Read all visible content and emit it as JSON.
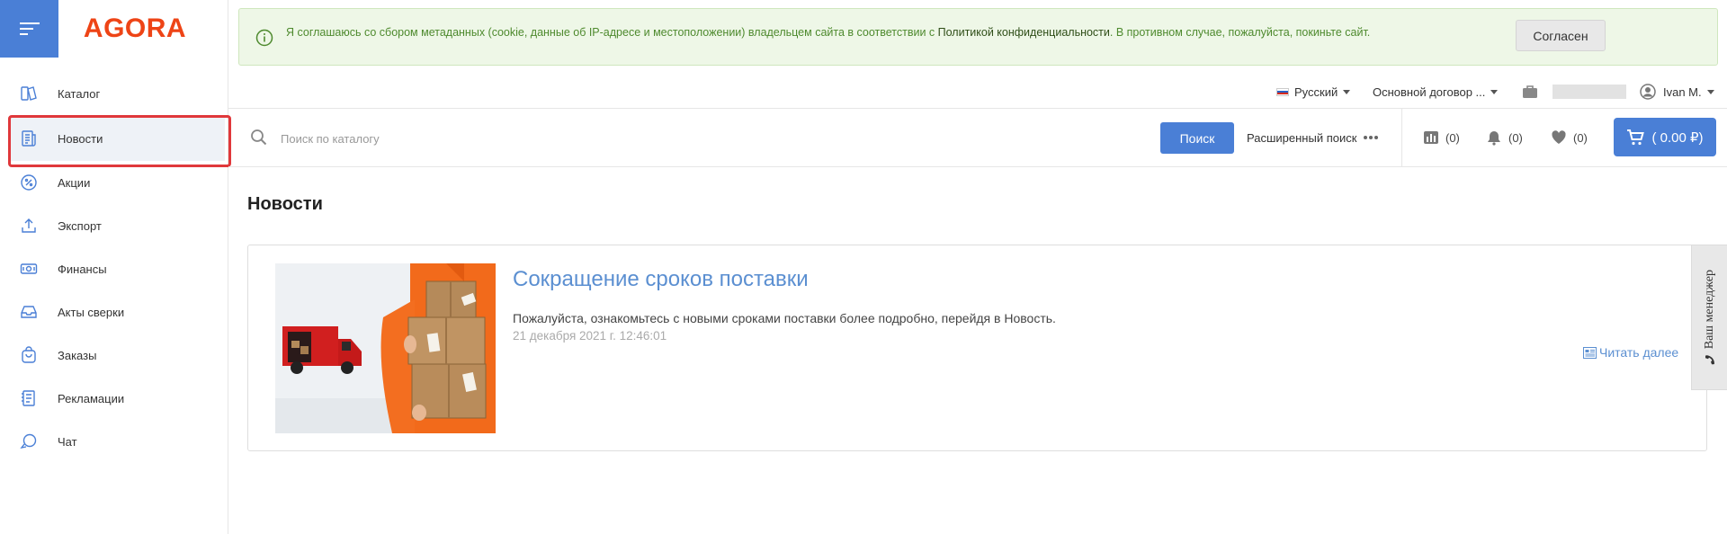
{
  "brand": {
    "logo_text": "AGORA",
    "accent": "#4a7fd6",
    "logo_color": "#ee4416"
  },
  "sidebar": {
    "items": [
      {
        "label": "Каталог",
        "icon": "catalog-icon"
      },
      {
        "label": "Новости",
        "icon": "news-icon",
        "active": true
      },
      {
        "label": "Акции",
        "icon": "percent-icon"
      },
      {
        "label": "Экспорт",
        "icon": "upload-icon"
      },
      {
        "label": "Финансы",
        "icon": "money-icon"
      },
      {
        "label": "Акты сверки",
        "icon": "inbox-icon"
      },
      {
        "label": "Заказы",
        "icon": "bag-icon"
      },
      {
        "label": "Рекламации",
        "icon": "claims-icon"
      },
      {
        "label": "Чат",
        "icon": "chat-icon"
      }
    ]
  },
  "cookie": {
    "text_before": "Я соглашаюсь со сбором метаданных (cookie, данные об IP-адресе и местоположении) владельцем сайта в соответствии с ",
    "link": "Политикой конфиденциальности",
    "text_after": ". В противном случае, пожалуйста, покиньте сайт.",
    "button": "Согласен"
  },
  "userbar": {
    "language": "Русский",
    "contract": "Основной договор ...",
    "user": "Ivan M."
  },
  "search": {
    "placeholder": "Поиск по каталогу",
    "button": "Поиск",
    "advanced": "Расширенный поиск"
  },
  "counters": {
    "compare": "(0)",
    "notifications": "(0)",
    "favorites": "(0)",
    "cart": "( 0.00 ₽)"
  },
  "page": {
    "title": "Новости"
  },
  "news": [
    {
      "title": "Сокращение сроков поставки",
      "description": "Пожалуйста, ознакомьтесь с новыми сроками поставки более подробно, перейдя в Новость.",
      "date": "21 декабря 2021 г. 12:46:01",
      "read_more": "Читать далее"
    }
  ],
  "manager_tab": "Ваш менеджер"
}
